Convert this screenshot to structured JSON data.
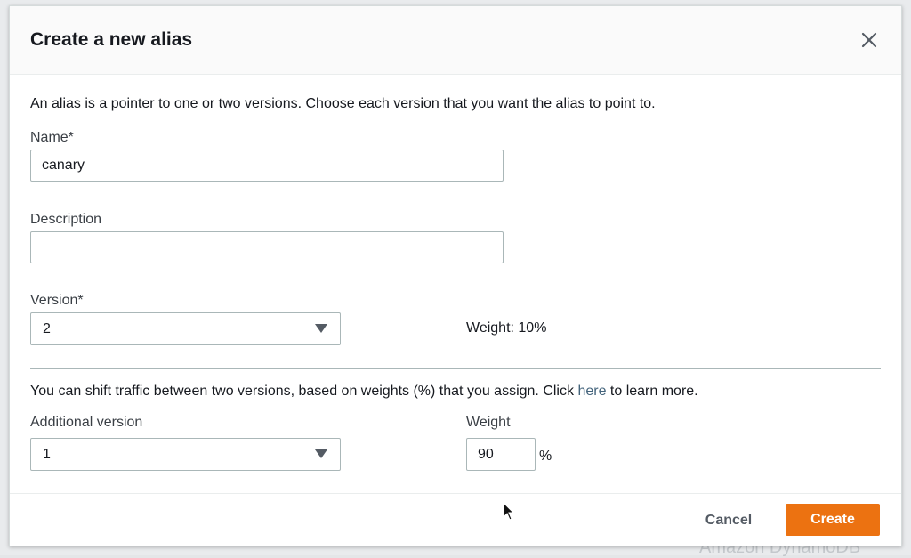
{
  "background": {
    "partial_text": "Amazon DynamoDB"
  },
  "dialog": {
    "title": "Create a new alias",
    "close_icon": "close-icon"
  },
  "form": {
    "intro": "An alias is a pointer to one or two versions. Choose each version that you want the alias to point to.",
    "name": {
      "label": "Name*",
      "value": "canary"
    },
    "description": {
      "label": "Description",
      "value": ""
    },
    "version": {
      "label": "Version*",
      "selected": "2",
      "weight_text": "Weight: 10%"
    },
    "shift_traffic": {
      "text_before": "You can shift traffic between two versions, based on weights (%) that you assign. Click ",
      "link": "here",
      "text_after": " to learn more."
    },
    "additional_version": {
      "label": "Additional version",
      "selected": "1"
    },
    "weight": {
      "label": "Weight",
      "value": "90",
      "unit": "%"
    }
  },
  "footer": {
    "cancel_label": "Cancel",
    "create_label": "Create"
  },
  "colors": {
    "primary_button": "#ec7211",
    "link": "#44647c",
    "border": "#aab7b8"
  }
}
